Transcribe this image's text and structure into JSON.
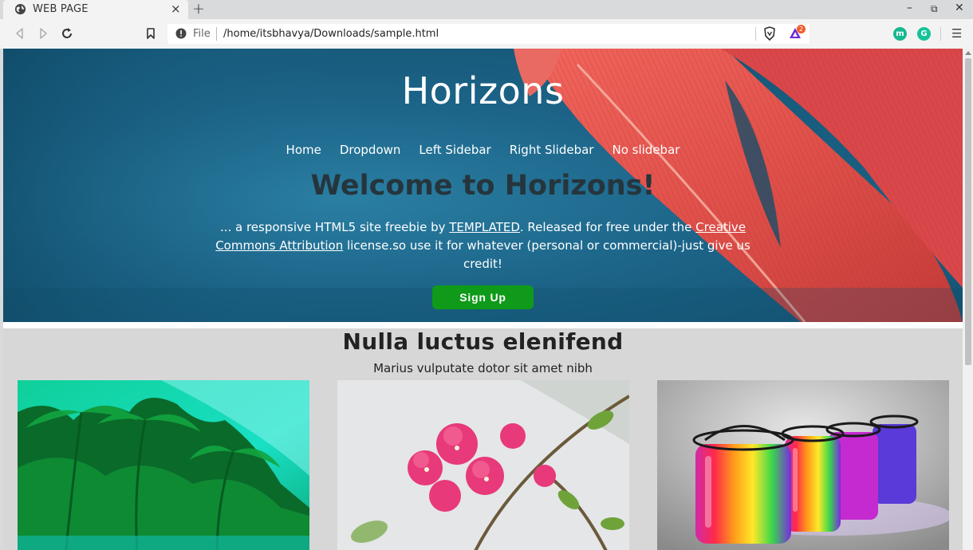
{
  "browser": {
    "tab_title": "WEB PAGE",
    "tab_close": "×",
    "new_tab": "+",
    "window_controls": {
      "minimize": "–",
      "restore": "⧉",
      "close": "✕"
    },
    "address_scheme": "File",
    "address_url": "/home/itsbhavya/Downloads/sample.html",
    "extension_badge_count": "2",
    "extensions": [
      {
        "icon": "m-extension-icon",
        "letter": "m",
        "color": "#17b890"
      },
      {
        "icon": "grammarly-icon",
        "letter": "G",
        "color": "#15c39a"
      }
    ],
    "menu": "☰"
  },
  "site": {
    "title": "Horizons",
    "nav": [
      "Home",
      "Dropdown",
      "Left Sidebar",
      "Right Slidebar",
      "No slidebar"
    ],
    "welcome": "Welcome to Horizons!",
    "intro_prefix": "... a responsive HTML5 site freebie by ",
    "intro_link1": "TEMPLATED",
    "intro_mid": ". Released for free under the ",
    "intro_link2": "Creative Commons Attribution",
    "intro_suffix": " license.so use it for whatever (personal or commercial)-just give us credit!",
    "signup": "Sign Up",
    "section_title": "Nulla luctus elenifend",
    "section_subtitle": "Marius vulputate dotor sit amet nibh",
    "cards": [
      "palm-trees-image",
      "bougainvillea-flowers-image",
      "rainbow-jars-image"
    ]
  },
  "colors": {
    "hero_blue": "#1c6488",
    "feather_red": "#e0504a",
    "signup_green": "#0f9a19",
    "welcome_text": "#26353c",
    "badge_red": "#f25c2a"
  }
}
